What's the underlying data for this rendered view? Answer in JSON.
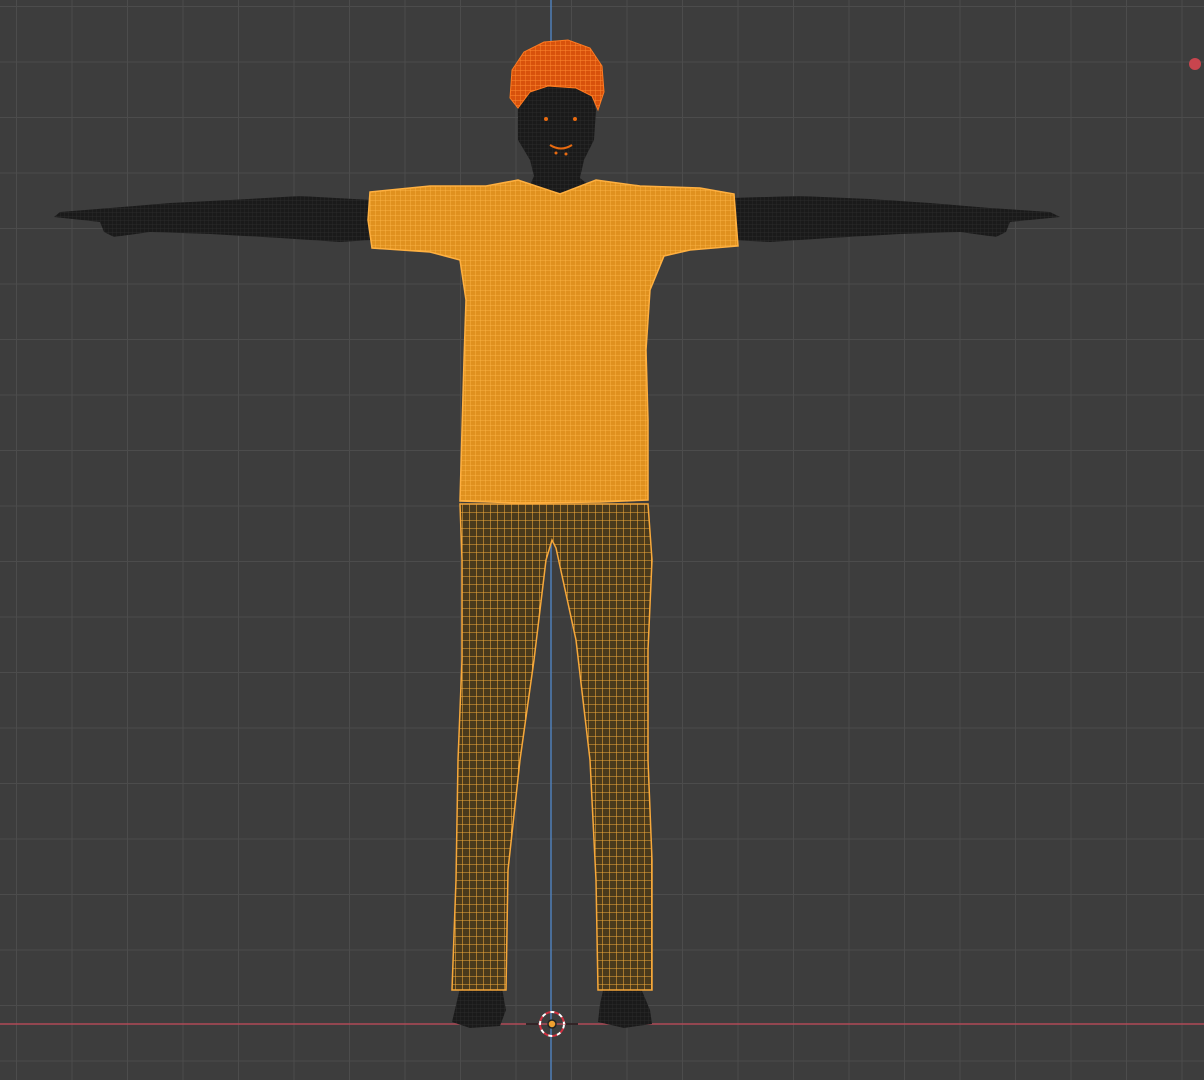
{
  "viewport": {
    "type": "3d-viewport",
    "view": "front-orthographic",
    "shading": "wireframe-overlay",
    "colors": {
      "background": "#3d3d3d",
      "grid": "#4c4c4c",
      "z_axis": "#4f7fb8",
      "x_axis": "#b04a56",
      "active_selection": "#e86a10",
      "selected": "#f29a2c",
      "body": "#1c1c1c",
      "origin": "#f0a030"
    },
    "objects": [
      {
        "name": "hair",
        "state": "active"
      },
      {
        "name": "body",
        "state": "unselected"
      },
      {
        "name": "shirt",
        "state": "selected"
      },
      {
        "name": "pants",
        "state": "selected"
      }
    ],
    "gizmos": [
      "3d-cursor",
      "object-origin",
      "light-indicator"
    ]
  }
}
